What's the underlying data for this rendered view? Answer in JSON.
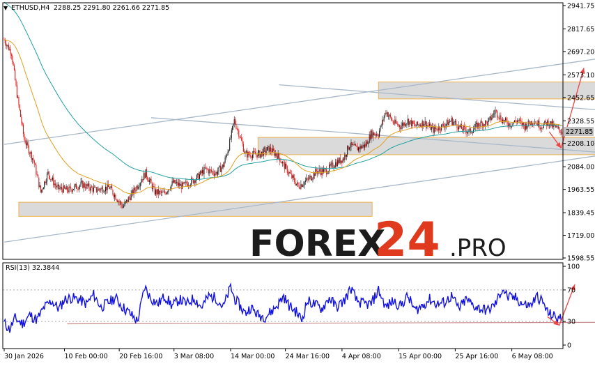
{
  "header": {
    "symbol_label": "ETHUSD,H4",
    "ohlc_text": "2288.25 2291.80 2261.66 2271.85"
  },
  "watermark": {
    "brand_main": "FOREX",
    "brand_number": "24",
    "brand_suffix": ".PRO"
  },
  "colors": {
    "bull": "#1a1a1a",
    "bear": "#e01010",
    "ma_fast": "#e0a020",
    "ma_slow": "#20a0a0",
    "rsi": "#1010e0",
    "zone_fill": "#d3d3d3",
    "zone_edge": "#f0b050",
    "trend": "#a8b8c8",
    "arrow": "#ee4444",
    "current_price_bg": "#c0c0c0"
  },
  "chart_data": [
    {
      "type": "candlestick",
      "current_price": 2271.85,
      "current_price_label": "2271.85",
      "ylim": [
        1598.55,
        2941.75
      ],
      "y_ticks": [
        {
          "value": 2941.75,
          "label": "2941.75"
        },
        {
          "value": 2817.65,
          "label": "2817.65"
        },
        {
          "value": 2697.2,
          "label": "2697.20"
        },
        {
          "value": 2573.1,
          "label": "2573.10"
        },
        {
          "value": 2452.65,
          "label": "2452.65"
        },
        {
          "value": 2328.55,
          "label": "2328.55"
        },
        {
          "value": 2208.1,
          "label": "2208.10"
        },
        {
          "value": 2084.0,
          "label": "2084.00"
        },
        {
          "value": 1963.55,
          "label": "1963.55"
        },
        {
          "value": 1839.45,
          "label": "1839.45"
        },
        {
          "value": 1719.0,
          "label": "1719.00"
        },
        {
          "value": 1598.55,
          "label": "1598.55"
        }
      ],
      "x_ticks": [
        {
          "bar": 0,
          "label": "30 Jan 2026"
        },
        {
          "bar": 66,
          "label": "10 Feb 00:00"
        },
        {
          "bar": 126,
          "label": "20 Feb 16:00"
        },
        {
          "bar": 186,
          "label": "3 Mar 08:00"
        },
        {
          "bar": 248,
          "label": "14 Mar 00:00"
        },
        {
          "bar": 308,
          "label": "24 Mar 16:00"
        },
        {
          "bar": 370,
          "label": "4 Apr 08:00"
        },
        {
          "bar": 432,
          "label": "15 Apr 00:00"
        },
        {
          "bar": 494,
          "label": "25 Apr 16:00"
        },
        {
          "bar": 556,
          "label": "6 May 08:00"
        }
      ],
      "bar_count": 612,
      "price_path": [
        [
          0,
          2760
        ],
        [
          8,
          2690
        ],
        [
          14,
          2470
        ],
        [
          22,
          2230
        ],
        [
          32,
          2120
        ],
        [
          40,
          1950
        ],
        [
          48,
          2050
        ],
        [
          58,
          1970
        ],
        [
          70,
          1960
        ],
        [
          85,
          1990
        ],
        [
          100,
          1960
        ],
        [
          115,
          1975
        ],
        [
          130,
          1870
        ],
        [
          140,
          1940
        ],
        [
          155,
          2050
        ],
        [
          165,
          1950
        ],
        [
          175,
          1940
        ],
        [
          185,
          2000
        ],
        [
          195,
          1980
        ],
        [
          210,
          2020
        ],
        [
          220,
          2070
        ],
        [
          232,
          2050
        ],
        [
          240,
          2090
        ],
        [
          246,
          2190
        ],
        [
          252,
          2330
        ],
        [
          258,
          2250
        ],
        [
          264,
          2150
        ],
        [
          272,
          2150
        ],
        [
          280,
          2150
        ],
        [
          290,
          2180
        ],
        [
          300,
          2140
        ],
        [
          312,
          2050
        ],
        [
          322,
          1980
        ],
        [
          334,
          2020
        ],
        [
          342,
          2060
        ],
        [
          352,
          2060
        ],
        [
          362,
          2100
        ],
        [
          372,
          2130
        ],
        [
          378,
          2200
        ],
        [
          386,
          2180
        ],
        [
          396,
          2200
        ],
        [
          402,
          2260
        ],
        [
          410,
          2260
        ],
        [
          418,
          2380
        ],
        [
          426,
          2320
        ],
        [
          434,
          2300
        ],
        [
          442,
          2330
        ],
        [
          450,
          2300
        ],
        [
          460,
          2320
        ],
        [
          470,
          2280
        ],
        [
          480,
          2300
        ],
        [
          490,
          2330
        ],
        [
          500,
          2290
        ],
        [
          510,
          2270
        ],
        [
          520,
          2310
        ],
        [
          530,
          2320
        ],
        [
          538,
          2380
        ],
        [
          546,
          2330
        ],
        [
          554,
          2310
        ],
        [
          562,
          2330
        ],
        [
          570,
          2300
        ],
        [
          580,
          2330
        ],
        [
          588,
          2300
        ],
        [
          596,
          2320
        ],
        [
          604,
          2290
        ],
        [
          611,
          2271.85
        ]
      ],
      "zones": [
        {
          "x_from": 410,
          "x_to": 773,
          "y_low": 2445,
          "y_high": 2535
        },
        {
          "x_from": 278,
          "x_to": 773,
          "y_low": 2148,
          "y_high": 2240
        },
        {
          "x_from": 16,
          "x_to": 403,
          "y_low": 1820,
          "y_high": 1895
        }
      ],
      "trendlines": [
        {
          "x1": 0,
          "y1": 2203,
          "x2": 773,
          "y2": 2745
        },
        {
          "x1": 0,
          "y1": 1683,
          "x2": 773,
          "y2": 2230
        },
        {
          "x1": 301,
          "y1": 2520,
          "x2": 773,
          "y2": 2340
        },
        {
          "x1": 161,
          "y1": 2345,
          "x2": 773,
          "y2": 2115
        }
      ],
      "forecast_arrows": [
        {
          "x1": 597,
          "y1": 2270,
          "x2": 610,
          "y2": 2183
        },
        {
          "x1": 610,
          "y1": 2183,
          "x2": 635,
          "y2": 2610
        }
      ]
    },
    {
      "type": "line",
      "indicator_label": "RSI(13) 32.3844",
      "ylim": [
        0,
        100
      ],
      "y_ticks": [
        {
          "value": 100,
          "label": "100"
        },
        {
          "value": 70,
          "label": "70"
        },
        {
          "value": 30,
          "label": "30"
        },
        {
          "value": 0,
          "label": "0"
        }
      ],
      "levels": [
        70,
        30
      ],
      "rsi_path": [
        [
          0,
          28
        ],
        [
          6,
          20
        ],
        [
          12,
          34
        ],
        [
          20,
          27
        ],
        [
          28,
          38
        ],
        [
          36,
          32
        ],
        [
          44,
          48
        ],
        [
          52,
          56
        ],
        [
          60,
          46
        ],
        [
          66,
          58
        ],
        [
          74,
          60
        ],
        [
          82,
          58
        ],
        [
          90,
          52
        ],
        [
          98,
          64
        ],
        [
          106,
          48
        ],
        [
          114,
          54
        ],
        [
          122,
          60
        ],
        [
          130,
          48
        ],
        [
          138,
          40
        ],
        [
          146,
          30
        ],
        [
          154,
          74
        ],
        [
          160,
          60
        ],
        [
          168,
          52
        ],
        [
          176,
          62
        ],
        [
          184,
          50
        ],
        [
          192,
          58
        ],
        [
          200,
          52
        ],
        [
          208,
          60
        ],
        [
          216,
          48
        ],
        [
          224,
          62
        ],
        [
          232,
          60
        ],
        [
          240,
          48
        ],
        [
          248,
          74
        ],
        [
          252,
          60
        ],
        [
          258,
          50
        ],
        [
          264,
          40
        ],
        [
          270,
          48
        ],
        [
          278,
          38
        ],
        [
          286,
          36
        ],
        [
          294,
          44
        ],
        [
          300,
          52
        ],
        [
          306,
          62
        ],
        [
          312,
          50
        ],
        [
          320,
          42
        ],
        [
          326,
          32
        ],
        [
          332,
          56
        ],
        [
          340,
          52
        ],
        [
          348,
          46
        ],
        [
          356,
          60
        ],
        [
          364,
          48
        ],
        [
          372,
          56
        ],
        [
          380,
          72
        ],
        [
          386,
          56
        ],
        [
          394,
          52
        ],
        [
          402,
          52
        ],
        [
          410,
          70
        ],
        [
          418,
          48
        ],
        [
          426,
          56
        ],
        [
          434,
          50
        ],
        [
          442,
          62
        ],
        [
          450,
          44
        ],
        [
          458,
          50
        ],
        [
          466,
          58
        ],
        [
          474,
          52
        ],
        [
          482,
          54
        ],
        [
          490,
          62
        ],
        [
          498,
          46
        ],
        [
          506,
          58
        ],
        [
          514,
          50
        ],
        [
          522,
          46
        ],
        [
          530,
          44
        ],
        [
          538,
          52
        ],
        [
          546,
          72
        ],
        [
          552,
          60
        ],
        [
          560,
          60
        ],
        [
          568,
          52
        ],
        [
          576,
          50
        ],
        [
          584,
          62
        ],
        [
          590,
          54
        ],
        [
          596,
          40
        ],
        [
          603,
          36
        ],
        [
          611,
          32.38
        ]
      ],
      "support_line": {
        "x1": 69,
        "y1": 27,
        "x2": 676,
        "y2": 29
      },
      "forecast_arrows": [
        {
          "x1": 595,
          "y1": 36,
          "x2": 608,
          "y2": 25
        },
        {
          "x1": 608,
          "y1": 25,
          "x2": 625,
          "y2": 77
        }
      ]
    }
  ]
}
